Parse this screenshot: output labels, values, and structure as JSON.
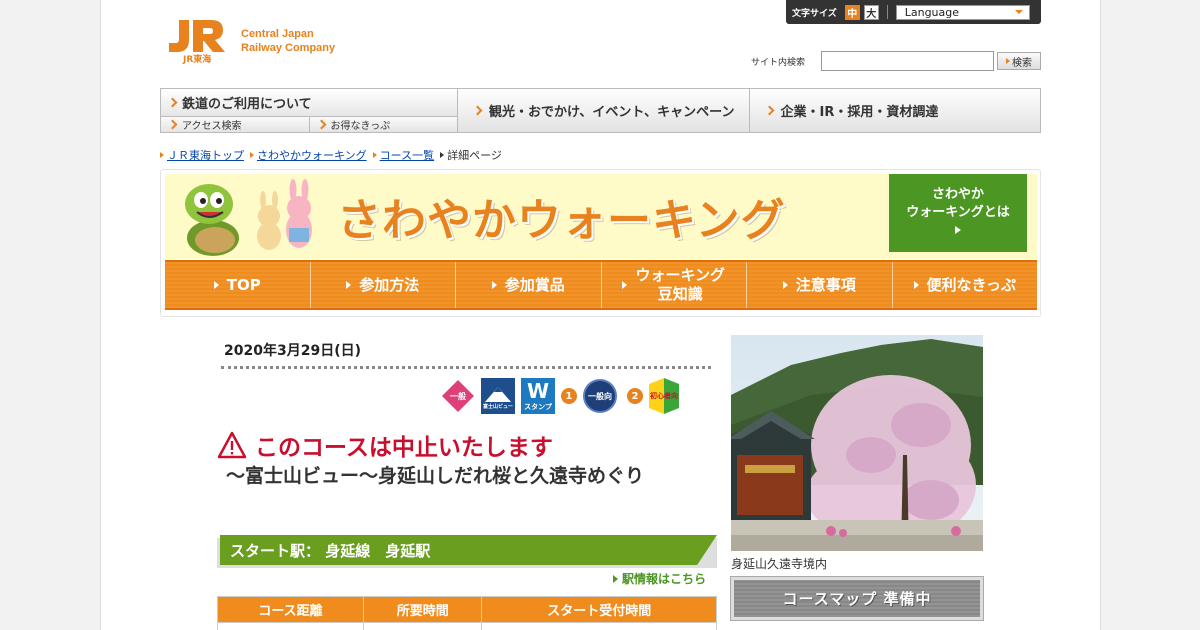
{
  "header": {
    "font_size_label": "文字サイズ",
    "font_size_options": [
      "中",
      "大"
    ],
    "language_label": "Language",
    "company_name_line1": "Central Japan",
    "company_name_line2": "Railway Company",
    "logo_text": "JR東海",
    "search_label": "サイト内検索",
    "search_value": "",
    "search_button": "検索"
  },
  "global_nav": {
    "rail_usage": "鉄道のご利用について",
    "access_search": "アクセス検索",
    "discount_tickets": "お得なきっぷ",
    "tourism": "観光・おでかけ、イベント、キャンペーン",
    "corporate": "企業・IR・採用・資材調達"
  },
  "breadcrumb": [
    "ＪＲ東海トップ",
    "さわやかウォーキング",
    "コース一覧",
    "詳細ページ"
  ],
  "banner": {
    "title": "さわやかウォーキング",
    "about_line1": "さわやか",
    "about_line2": "ウォーキングとは"
  },
  "orange_nav": [
    {
      "label": "TOP"
    },
    {
      "label": "参加方法"
    },
    {
      "label": "参加賞品"
    },
    {
      "label_line1": "ウォーキング",
      "label_line2": "豆知識"
    },
    {
      "label": "注意事項"
    },
    {
      "label": "便利なきっぷ"
    }
  ],
  "event": {
    "date": "2020年3月29日(日)",
    "badges": {
      "general_course": "一般",
      "fuji_view": "富士山ビュー",
      "stamp": "スタンプ",
      "stamp_letter": "W",
      "num1": "1",
      "general_level": "一般向",
      "num2": "2",
      "beginner": "初心者向"
    },
    "cancel_notice": "このコースは中止いたします",
    "course_title": "～富士山ビュー～身延山しだれ桜と久遠寺めぐり",
    "start_station": "スタート駅： 身延線　身延駅",
    "station_info_link": "駅情報はこちら",
    "table_headers": [
      "コース距離",
      "所要時間",
      "スタート受付時間"
    ]
  },
  "sidebar": {
    "photo_caption": "身延山久遠寺境内",
    "course_map_button": "コースマップ 準備中"
  },
  "colors": {
    "orange": "#f08c1e",
    "green": "#6a9e1f",
    "red": "#c8102e"
  }
}
